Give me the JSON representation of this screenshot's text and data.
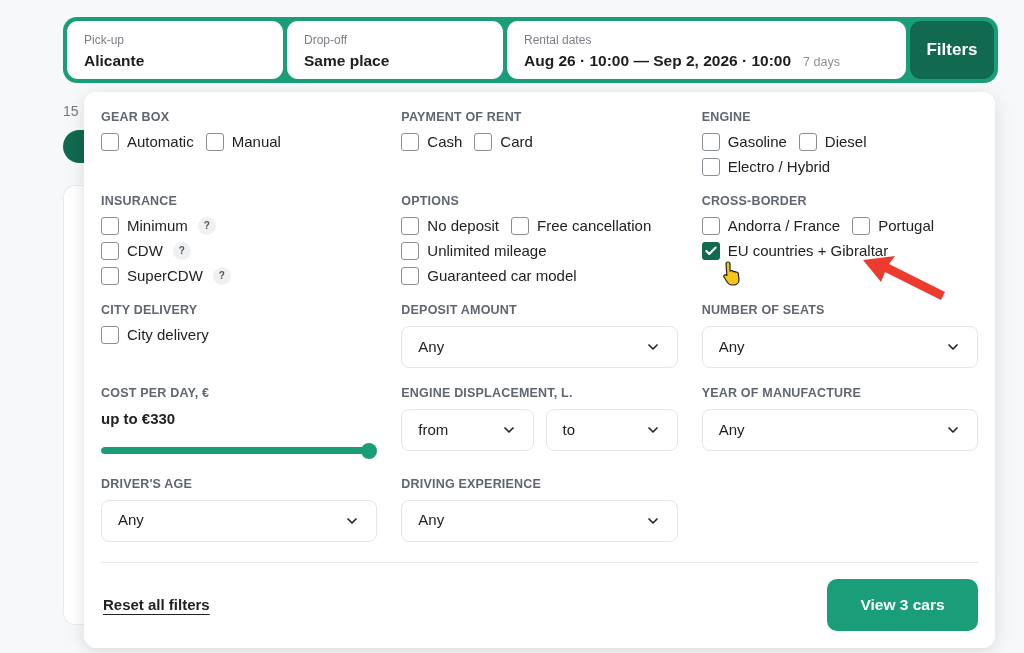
{
  "search_bar": {
    "fields": [
      {
        "label": "Pick-up",
        "value": "Alicante"
      },
      {
        "label": "Drop-off",
        "value": "Same place"
      },
      {
        "label": "Rental dates",
        "value": "Aug 26 · 10:00 — Sep 2, 2026 · 10:00",
        "note": "7 days"
      }
    ],
    "filters_button": "Filters"
  },
  "background": {
    "results_count": "15"
  },
  "filters_panel": {
    "sections": [
      {
        "kind": "checkboxes",
        "title": "GEAR BOX",
        "stacked": false,
        "options": [
          {
            "label": "Automatic",
            "checked": false
          },
          {
            "label": "Manual",
            "checked": false
          }
        ]
      },
      {
        "kind": "checkboxes",
        "title": "PAYMENT OF RENT",
        "stacked": false,
        "options": [
          {
            "label": "Cash",
            "checked": false
          },
          {
            "label": "Card",
            "checked": false
          }
        ]
      },
      {
        "kind": "checkboxes",
        "title": "ENGINE",
        "stacked": false,
        "options": [
          {
            "label": "Gasoline",
            "checked": false
          },
          {
            "label": "Diesel",
            "checked": false
          },
          {
            "label": "Electro / Hybrid",
            "checked": false
          }
        ]
      },
      {
        "kind": "checkboxes",
        "title": "INSURANCE",
        "stacked": true,
        "options": [
          {
            "label": "Minimum",
            "checked": false,
            "hint": "?"
          },
          {
            "label": "CDW",
            "checked": false,
            "hint": "?"
          },
          {
            "label": "SuperCDW",
            "checked": false,
            "hint": "?"
          }
        ]
      },
      {
        "kind": "checkboxes",
        "title": "OPTIONS",
        "stacked": false,
        "options": [
          {
            "label": "No deposit",
            "checked": false
          },
          {
            "label": "Free cancellation",
            "checked": false
          },
          {
            "label": "Unlimited mileage",
            "checked": false
          },
          {
            "label": "Guaranteed car model",
            "checked": false
          }
        ]
      },
      {
        "kind": "checkboxes",
        "title": "CROSS-BORDER",
        "stacked": false,
        "options": [
          {
            "label": "Andorra / France",
            "checked": false
          },
          {
            "label": "Portugal",
            "checked": false
          },
          {
            "label": "EU countries + Gibraltar",
            "checked": true
          }
        ]
      },
      {
        "kind": "checkboxes",
        "title": "CITY DELIVERY",
        "options": [
          {
            "label": "City delivery",
            "checked": false
          }
        ]
      },
      {
        "kind": "select",
        "title": "DEPOSIT AMOUNT",
        "values": [
          "Any"
        ]
      },
      {
        "kind": "select",
        "title": "NUMBER OF SEATS",
        "values": [
          "Any"
        ]
      },
      {
        "kind": "slider",
        "title": "COST PER DAY, €",
        "reading": "up to €330",
        "level": 1
      },
      {
        "kind": "select",
        "title": "ENGINE DISPLACEMENT, L.",
        "values": [
          "from",
          "to"
        ]
      },
      {
        "kind": "select",
        "title": "YEAR OF MANUFACTURE",
        "values": [
          "Any"
        ]
      },
      {
        "kind": "select",
        "title": "DRIVER'S AGE",
        "values": [
          "Any"
        ]
      },
      {
        "kind": "select",
        "title": "DRIVING EXPERIENCE",
        "values": [
          "Any"
        ]
      }
    ],
    "reset_link": "Reset all filters",
    "view_button": "View 3 cars"
  }
}
